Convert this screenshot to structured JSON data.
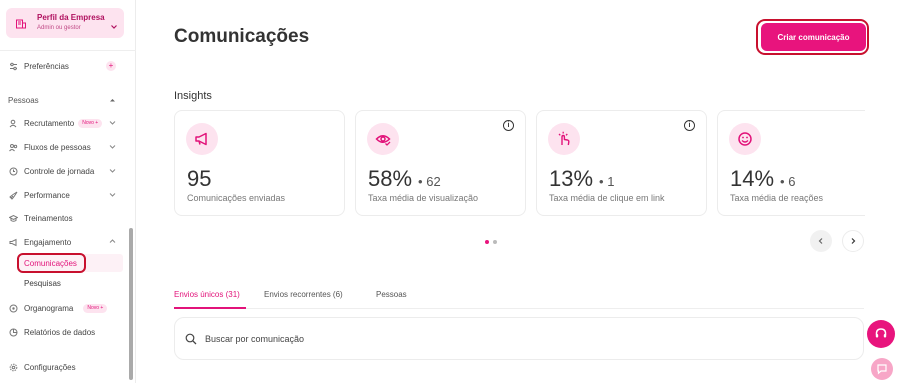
{
  "colors": {
    "accent": "#e8147d",
    "accent_soft": "#fde3ef",
    "outline": "#c8102e"
  },
  "sidebar": {
    "profile": {
      "name": "Perfil da Empresa",
      "role": "Admin ou gestor",
      "icon": "building-icon"
    },
    "preferences": {
      "label": "Preferências",
      "badge": "+"
    },
    "section": "Pessoas",
    "items": [
      {
        "label": "Recrutamento",
        "badge": "Novo +",
        "icon": "person-search-icon"
      },
      {
        "label": "Fluxos de pessoas",
        "icon": "people-flow-icon"
      },
      {
        "label": "Controle de jornada",
        "icon": "clock-icon"
      },
      {
        "label": "Performance",
        "icon": "rocket-icon"
      },
      {
        "label": "Treinamentos",
        "icon": "graduation-cap-icon"
      },
      {
        "label": "Engajamento",
        "icon": "megaphone-icon"
      }
    ],
    "sub_items": [
      {
        "label": "Comunicações",
        "active": true
      },
      {
        "label": "Pesquisas"
      }
    ],
    "organograma": {
      "label": "Organograma",
      "badge": "Novo +"
    },
    "relatorios": {
      "label": "Relatórios de dados"
    },
    "configuracoes": {
      "label": "Configurações"
    }
  },
  "header": {
    "title": "Comunicações",
    "create_button": "Criar comunicação"
  },
  "insights": {
    "title": "Insights",
    "cards": [
      {
        "value": "95",
        "secondary": "",
        "label": "Comunicações enviadas",
        "icon": "megaphone-icon"
      },
      {
        "value": "58%",
        "secondary": "• 62",
        "label": "Taxa média de visualização",
        "icon": "eye-check-icon"
      },
      {
        "value": "13%",
        "secondary": "• 1",
        "label": "Taxa média de clique em link",
        "icon": "hand-click-icon"
      },
      {
        "value": "14%",
        "secondary": "• 6",
        "label": "Taxa média de reações",
        "icon": "smiley-icon"
      }
    ],
    "pages": 2,
    "current_page": 1
  },
  "tabs": [
    {
      "label": "Envios únicos (31)",
      "active": true
    },
    {
      "label": "Envios recorrentes (6)"
    },
    {
      "label": "Pessoas"
    }
  ],
  "search": {
    "placeholder": "Buscar por comunicação"
  }
}
